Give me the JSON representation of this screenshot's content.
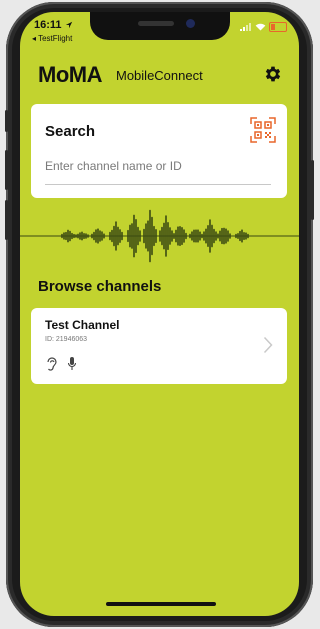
{
  "status_bar": {
    "time": "16:11",
    "back_label": "◂ TestFlight"
  },
  "header": {
    "logo": "MoMA",
    "app_name": "MobileConnect",
    "settings_icon": "gear-icon"
  },
  "search": {
    "title": "Search",
    "placeholder": "Enter channel name or ID",
    "value": "",
    "qr_icon": "qr-code-icon"
  },
  "browse": {
    "title": "Browse channels",
    "channels": [
      {
        "name": "Test Channel",
        "id_text": "ID: 21946063",
        "icons": [
          "ear-icon",
          "microphone-icon"
        ]
      }
    ]
  },
  "colors": {
    "background": "#c2d32f",
    "card": "#ffffff",
    "accent": "#e8672b",
    "text": "#111111"
  }
}
